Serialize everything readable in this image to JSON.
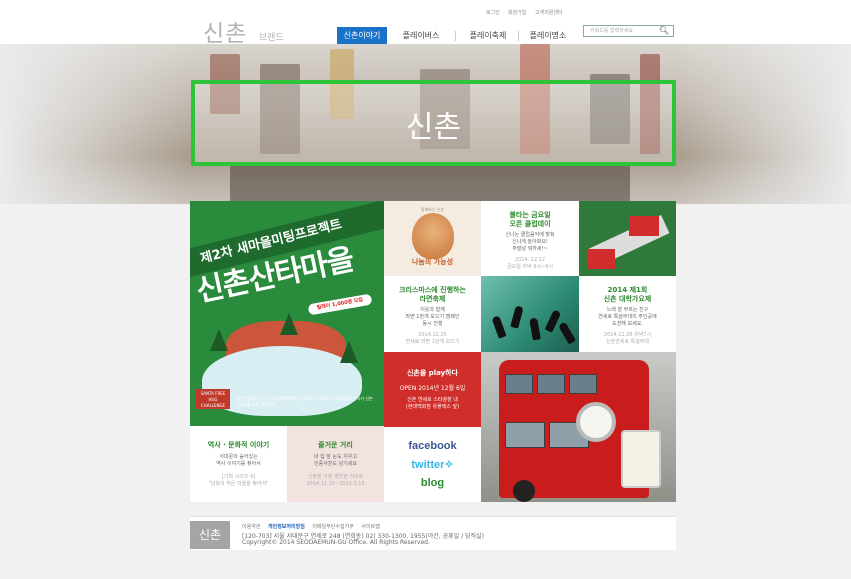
{
  "header": {
    "logo": "신촌",
    "logo_sub": "브랜드",
    "util_links": [
      "로그인",
      "회원가입",
      "고객지원센터"
    ],
    "nav": [
      "신촌이야기",
      "플레이버스",
      "플레이축제",
      "플레이명소"
    ],
    "search_placeholder": "키워드를 입력하세요"
  },
  "hero": {
    "title": "신촌"
  },
  "banner": {
    "ribbon": "제2차 새마을미팅프로젝트",
    "title": "신촌산타마을",
    "pill": "릴레이 1,000명 모집",
    "santa": "SANTA FREE HUG CHALLENGE",
    "desc": "신촌의 밤을 산타가 되어 따뜻하게 만들 준비가 되셨나요? 1,000명의 산타가 신촌 연세로를 가득 채웁니다."
  },
  "tiles": {
    "poster": {
      "top": "함께하는 신촌",
      "caption": "나눔의 가능성"
    },
    "club": {
      "title": "불타는 금요일\n오픈 클럽데이",
      "desc": "신나는 클럽음악에 맞춰\n신나게 놀아봐요!\n주말날 뭐하세!~",
      "date": "2014. 12.12\n금요일 저녁 9시~9시"
    },
    "fest": {
      "title": "크리스마스에 진행하는\n라면축제",
      "desc": "이웃과 함께\n라면 1만개 모으기 캠페인\n동시 진행",
      "date": "2014.12.25\n연세로 라면 1만개 모으기"
    },
    "univ": {
      "title": "2014 제1회\n신촌 대학가요제",
      "desc": "노래 잘 부르는 친구\n연세로 특설무대의 주인공에\n도전해 보세요.",
      "date": "2014.12.26 저녁7시\n신촌연세로 특설무대"
    },
    "play": {
      "title": "신촌을 play하다",
      "open": "OPEN 2014년 12월 6일",
      "desc": "신촌 연세로 스타광장 내\n(현대백화점 유플렉스 앞)"
    },
    "history": {
      "title": "역사 · 문화적 이야기",
      "desc": "서대문의 숨어있는\n역사 이야기를 찾아서",
      "note": "[기획 시리즈 4]\n\"남북의 작은 마을을 찾아서\""
    },
    "street": {
      "title": "즐거운 거리",
      "desc": "내 집 앞 눈도 치우고\n인증사진도 남기세요",
      "note": "신촌을 가장 깨끗한 거리로\n2014.11.10~2015.3.15"
    },
    "social": {
      "facebook": "facebook",
      "twitter": "twitter",
      "blog": "blog"
    }
  },
  "footer": {
    "logo": "신촌",
    "links": [
      "이용약관",
      "개인정보처리방침",
      "이메일무단수집거부",
      "사이트맵"
    ],
    "address": "[120-703] 서울 서대문구 연세로 248 (연희동) 02) 330-1300, 1955(야간, 공휴일 / 당직실)",
    "copyright": "Copyright© 2014 SEODAEMUN-GU Office. All Rights Reserved."
  }
}
